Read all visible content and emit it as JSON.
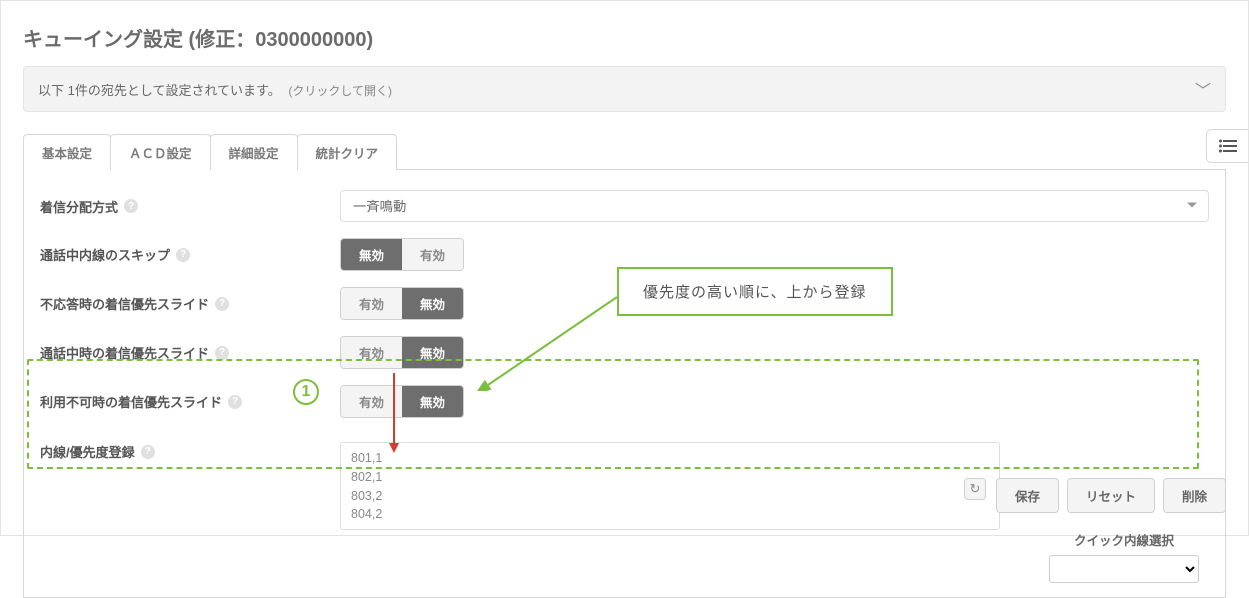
{
  "page_title": "キューイング設定 (修正：0300000000)",
  "expander": {
    "text": "以下 1件の宛先として設定されています。",
    "hint": "(クリックして開く)"
  },
  "tabs": [
    {
      "label": "基本設定"
    },
    {
      "label": "ＡＣＤ設定"
    },
    {
      "label": "詳細設定"
    },
    {
      "label": "統計クリア"
    }
  ],
  "active_tab_index": 1,
  "form": {
    "distribution": {
      "label": "着信分配方式",
      "value": "一斉鳴動"
    },
    "skip_busy": {
      "label": "通話中内線のスキップ",
      "left": "無効",
      "right": "有効",
      "active": "left"
    },
    "slide_noanswer": {
      "label": "不応答時の着信優先スライド",
      "left": "有効",
      "right": "無効",
      "active": "right"
    },
    "slide_busy": {
      "label": "通話中時の着信優先スライド",
      "left": "有効",
      "right": "無効",
      "active": "right"
    },
    "slide_unavail": {
      "label": "利用不可時の着信優先スライド",
      "left": "有効",
      "right": "無効",
      "active": "right"
    },
    "priority": {
      "label": "内線/優先度登録",
      "value": "801,1\n802,1\n803,2\n804,2"
    },
    "quick": {
      "label": "クイック内線選択"
    }
  },
  "annotations": {
    "badge": "1",
    "callout": "優先度の高い順に、上から登録"
  },
  "buttons": {
    "save": "保存",
    "reset": "リセット",
    "delete": "削除"
  }
}
